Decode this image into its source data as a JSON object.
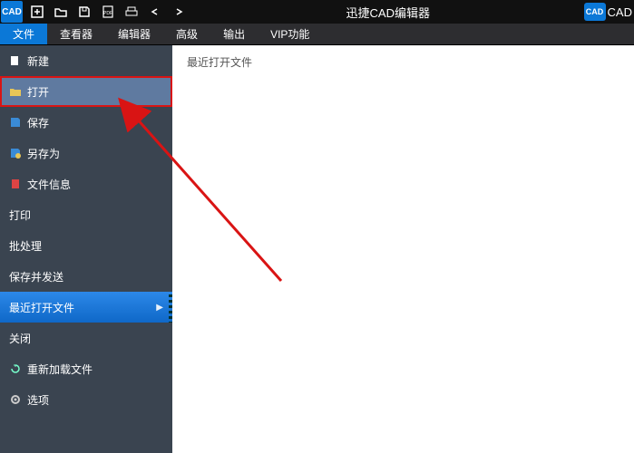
{
  "titlebar": {
    "logo_text": "CAD",
    "title": "迅捷CAD编辑器",
    "right_logo": "CAD",
    "right_text": "CAD"
  },
  "menubar": {
    "tabs": [
      {
        "label": "文件",
        "active": true
      },
      {
        "label": "查看器"
      },
      {
        "label": "编辑器"
      },
      {
        "label": "高级"
      },
      {
        "label": "输出"
      },
      {
        "label": "VIP功能"
      }
    ]
  },
  "sidebar": {
    "items": [
      {
        "label": "新建",
        "icon": "new-file-icon"
      },
      {
        "label": "打开",
        "icon": "folder-open-icon",
        "highlight": true
      },
      {
        "label": "保存",
        "icon": "save-icon"
      },
      {
        "label": "另存为",
        "icon": "save-as-icon"
      },
      {
        "label": "文件信息",
        "icon": "file-info-icon"
      },
      {
        "label": "打印"
      },
      {
        "label": "批处理"
      },
      {
        "label": "保存并发送"
      },
      {
        "label": "最近打开文件",
        "selected": true,
        "chev": true
      },
      {
        "label": "关闭"
      },
      {
        "label": "重新加载文件",
        "icon": "reload-icon"
      },
      {
        "label": "选项",
        "icon": "gear-icon"
      }
    ]
  },
  "content": {
    "heading": "最近打开文件"
  },
  "annotation": {
    "color": "#d91414"
  }
}
